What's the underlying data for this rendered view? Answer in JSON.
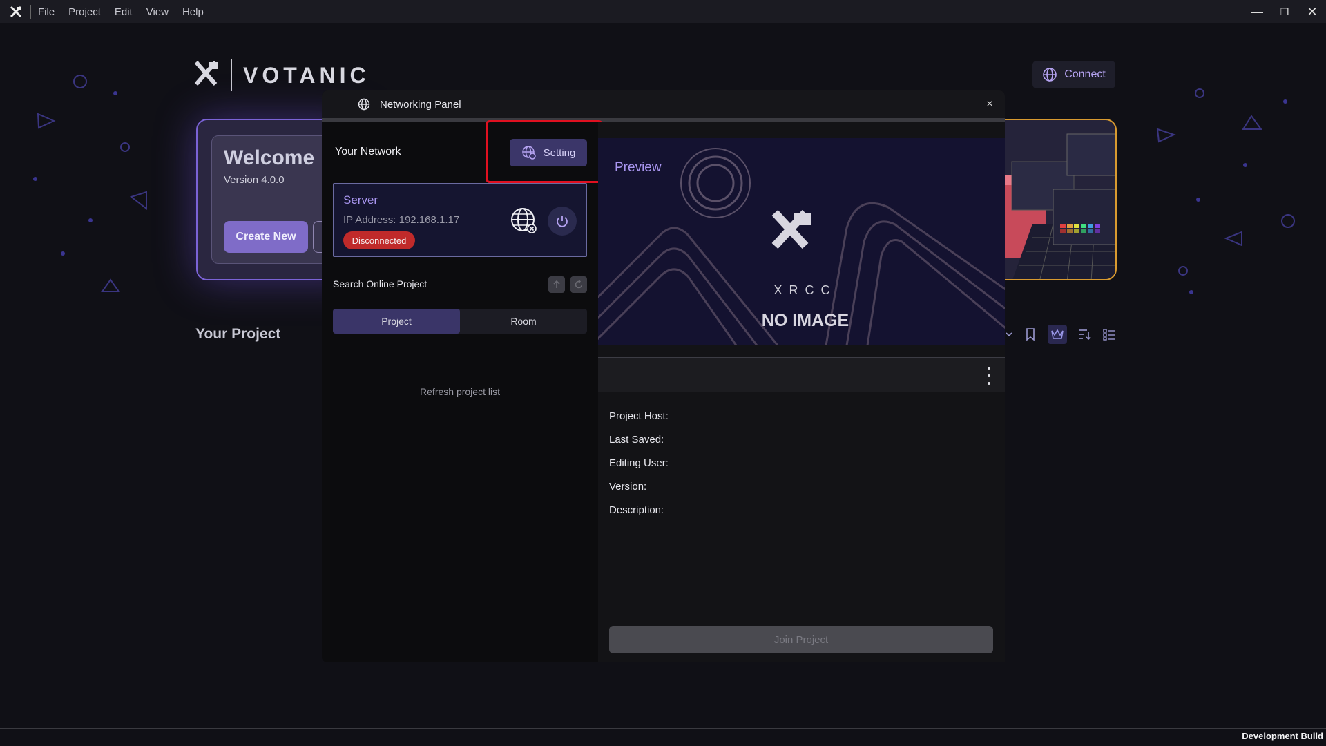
{
  "titlebar": {
    "menu": [
      "File",
      "Project",
      "Edit",
      "View",
      "Help"
    ],
    "controls": {
      "minimize": "—",
      "restore": "❐",
      "close": "✕"
    }
  },
  "brand": {
    "name": "VOTANIC"
  },
  "connect": {
    "label": "Connect"
  },
  "welcome": {
    "title": "Welcome",
    "version": "Version 4.0.0",
    "create_new": "Create New"
  },
  "your_project": "Your Project",
  "dialog": {
    "title": "Networking Panel",
    "close": "×",
    "your_network": "Your Network",
    "setting_label": "Setting",
    "server": {
      "title": "Server",
      "ip": "IP Address: 192.168.1.17",
      "status": "Disconnected"
    },
    "search_label": "Search Online Project",
    "tabs": [
      "Project",
      "Room"
    ],
    "refresh": "Refresh project list",
    "preview_label": "Preview",
    "no_image": "NO IMAGE",
    "xrcc": "XRCC",
    "info": {
      "project_host": "Project Host:",
      "last_saved": "Last Saved:",
      "editing_user": "Editing User:",
      "version": "Version:",
      "description": "Description:"
    },
    "join": "Join Project"
  },
  "footer": {
    "build": "Development Build"
  },
  "colors": {
    "accent": "#a996f0",
    "highlight": "#e01020",
    "disconnected": "#c02a2a"
  }
}
